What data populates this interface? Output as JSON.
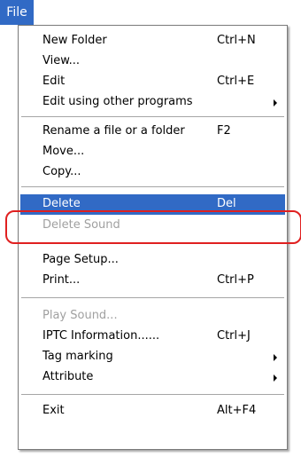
{
  "menubar": {
    "file_label": "File"
  },
  "menu": {
    "new_folder": {
      "label": "New Folder",
      "shortcut": "Ctrl+N"
    },
    "view": {
      "label": "View..."
    },
    "edit": {
      "label": "Edit",
      "shortcut": "Ctrl+E"
    },
    "edit_other": {
      "label": "Edit using other programs"
    },
    "rename": {
      "label": "Rename a file or a folder",
      "shortcut": "F2"
    },
    "move": {
      "label": "Move..."
    },
    "copy": {
      "label": "Copy..."
    },
    "delete": {
      "label": "Delete",
      "shortcut": "Del"
    },
    "delete_sound": {
      "label": "Delete Sound"
    },
    "page_setup": {
      "label": "Page Setup..."
    },
    "print": {
      "label": "Print...",
      "shortcut": "Ctrl+P"
    },
    "play_sound": {
      "label": "Play Sound..."
    },
    "iptc": {
      "label": "IPTC Information......",
      "shortcut": "Ctrl+J"
    },
    "tag_marking": {
      "label": "Tag marking"
    },
    "attribute": {
      "label": "Attribute"
    },
    "exit": {
      "label": "Exit",
      "shortcut": "Alt+F4"
    }
  },
  "colors": {
    "highlight": "#316ac5",
    "annotation": "#e02020",
    "disabled_text": "#a0a0a0"
  }
}
